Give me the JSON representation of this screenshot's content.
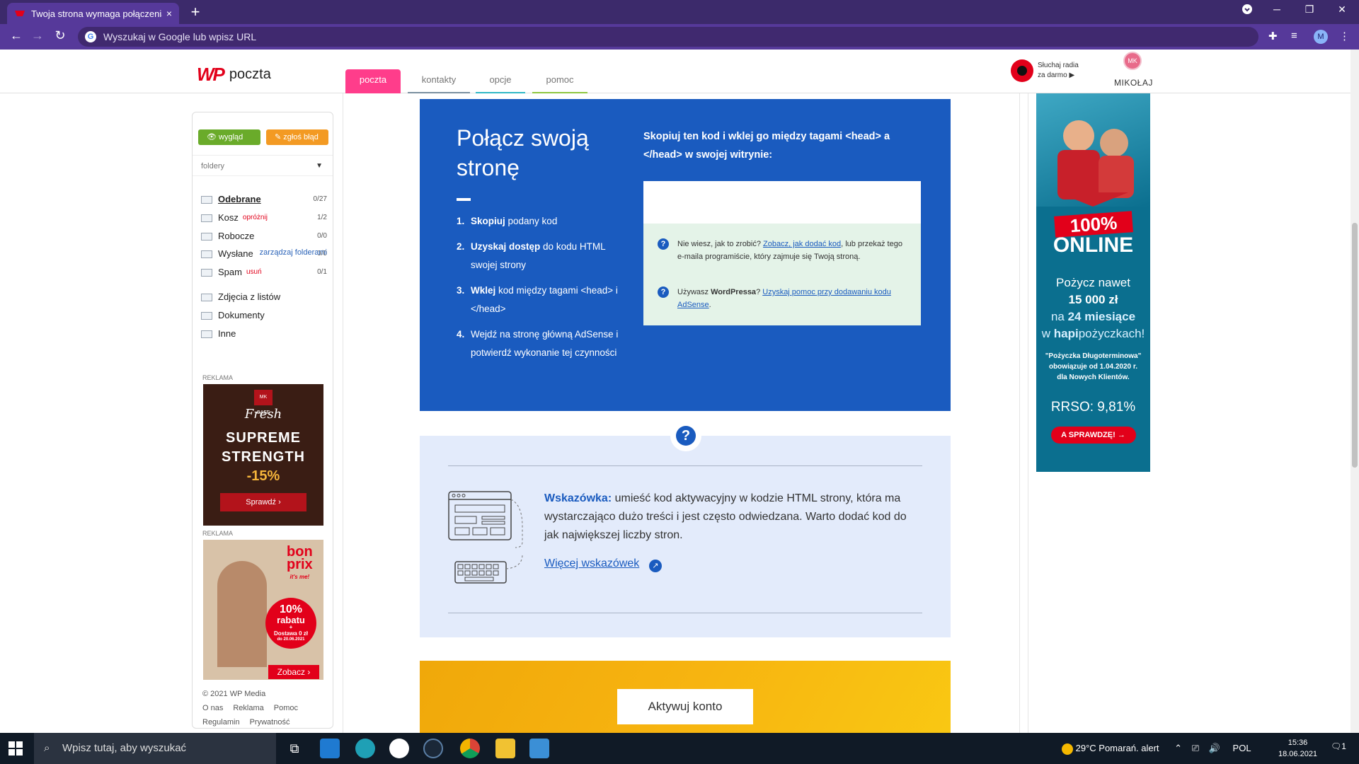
{
  "browser": {
    "tab_title": "Twoja strona wymaga połączenia",
    "tab_close": "×",
    "new_tab": "+",
    "omnibox_placeholder": "Wyszukaj w Google lub wpisz URL",
    "profile_initial": "M"
  },
  "header": {
    "logo_mark": "WP",
    "logo_name": "poczta",
    "tabs": [
      {
        "label": "poczta",
        "color": "#ff3d8b"
      },
      {
        "label": "kontakty",
        "color": "#7a8fa0"
      },
      {
        "label": "opcje",
        "color": "#2fb7c6"
      },
      {
        "label": "pomoc",
        "color": "#8dc63f"
      }
    ],
    "radio_line1": "Słuchaj radia",
    "radio_line2": "za darmo",
    "avatar_initials": "MK",
    "username": "MIKOŁAJ"
  },
  "sidebar": {
    "btn_look": "wygląd",
    "btn_report": "zgłoś błąd",
    "folders_label": "foldery",
    "folders": [
      {
        "label": "Odebrane",
        "count": "0/27",
        "action": ""
      },
      {
        "label": "Kosz",
        "count": "1/2",
        "action": "opróżnij"
      },
      {
        "label": "Robocze",
        "count": "0/0",
        "action": ""
      },
      {
        "label": "Wysłane",
        "count": "0/0",
        "action": ""
      },
      {
        "label": "Spam",
        "count": "0/1",
        "action": "usuń"
      }
    ],
    "manage_folders": "zarządzaj folderami",
    "extra_folders": [
      "Zdjęcia z listów",
      "Dokumenty",
      "Inne"
    ],
    "ad_label": "REKLAMA",
    "ad1": {
      "brand": "MK CAFE",
      "script": "Fresh",
      "line1": "SUPREME",
      "line2": "STRENGTH",
      "discount": "-15%",
      "cta": "Sprawdź"
    },
    "ad2": {
      "brand_top": "bon",
      "brand_bottom": "prix",
      "tagline": "it's me!",
      "pct": "10%",
      "rabat": "rabatu",
      "plus": "+",
      "delivery": "Dostawa 0 zł",
      "until": "do 20.06.2021",
      "cta": "Zobacz"
    },
    "copyright": "© 2021 WP Media",
    "links": [
      "O nas",
      "Reklama",
      "Pomoc",
      "Regulamin",
      "Prywatność"
    ]
  },
  "main": {
    "title": "Połącz swoją stronę",
    "steps": [
      {
        "num": "1.",
        "bold": "Skopiuj",
        "text": " podany kod"
      },
      {
        "num": "2.",
        "bold": "Uzyskaj dostęp",
        "text": " do kodu HTML swojej strony"
      },
      {
        "num": "3.",
        "bold": "Wklej",
        "text": " kod między tagami <head> i </head>"
      },
      {
        "num": "4.",
        "bold": "",
        "text": "Wejdź na stronę główną AdSense i potwierdź wykonanie tej czynności"
      }
    ],
    "copy_instruction": "Skopiuj ten kod i wklej go między tagami <head> a </head> w swojej witrynie:",
    "help1_pre": "Nie wiesz, jak to zrobić? ",
    "help1_link": "Zobacz, jak dodać kod",
    "help1_post": ", lub przekaż tego e-maila programiście, który zajmuje się Twoją stroną.",
    "help2_pre": "Używasz ",
    "help2_bold": "WordPressa",
    "help2_mid": "? ",
    "help2_link": "Uzyskaj pomoc przy dodawaniu kodu AdSense",
    "help2_post": "."
  },
  "tip": {
    "label": "Wskazówka:",
    "text": " umieść kod aktywacyjny w kodzie HTML strony, która ma wystarczająco dużo treści i jest często odwiedzana. Warto dodać kod do jak największej liczby stron.",
    "link": "Więcej wskazówek"
  },
  "cta": {
    "activate": "Aktywuj konto"
  },
  "right_ad": {
    "pct": "100%",
    "online": "ONLINE",
    "l1": "Pożycz nawet",
    "amount": "15 000 zł",
    "l2_pre": "na ",
    "l2_bold": "24 miesiące",
    "l3_pre": "w ",
    "l3_bold": "hapi",
    "l3_post": "pożyczkach!",
    "fine": "\"Pożyczka Długoterminowa\" obowiązuje od 1.04.2020 r. dla Nowych Klientów.",
    "rrso": "RRSO: 9,81%",
    "cta": "A SPRAWDZĘ!"
  },
  "taskbar": {
    "search_placeholder": "Wpisz tutaj, aby wyszukać",
    "weather": "29°C  Pomarań. alert",
    "lang": "POL",
    "time": "15:36",
    "date": "18.06.2021",
    "notif_count": "1"
  }
}
